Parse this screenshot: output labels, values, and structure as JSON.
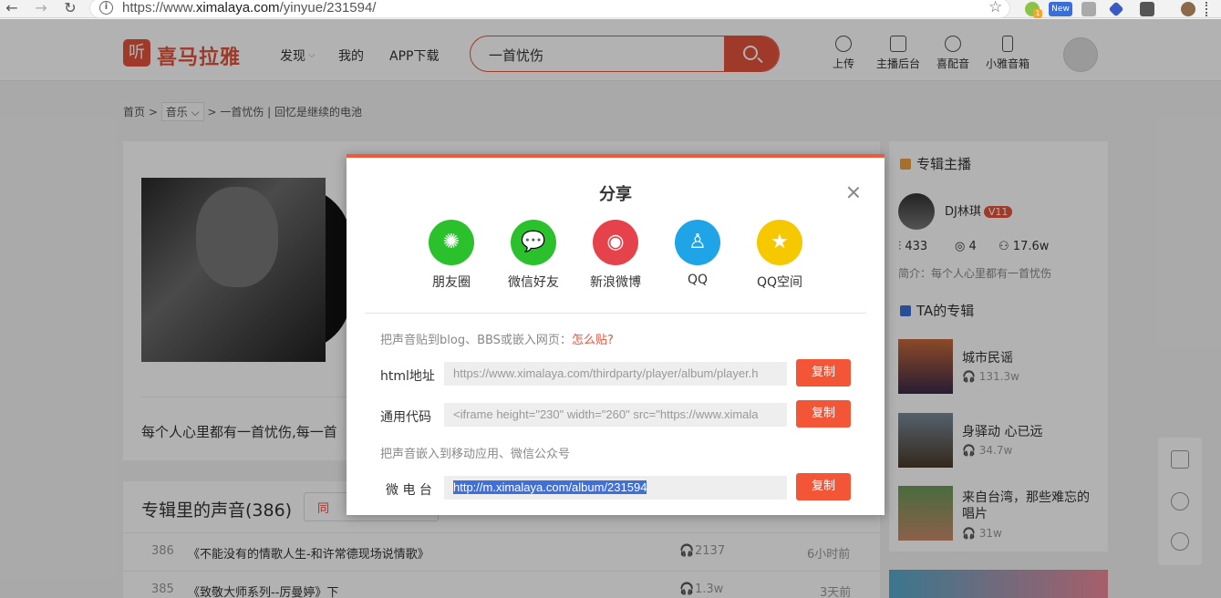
{
  "browser": {
    "back": "←",
    "forward": "→",
    "reload": "↻",
    "url_info": "i",
    "url_prefix": "https://www.",
    "url_domain": "ximalaya.com",
    "url_path": "/yinyue/231594/",
    "star": "☆",
    "ext_badge_new": "New",
    "ext_badge_count": "1"
  },
  "header": {
    "logo_glyph": "听",
    "logo_text": "喜马拉雅",
    "nav": [
      "发现",
      "我的",
      "APP下载"
    ],
    "search_value": "一首忧伤",
    "tools": [
      "上传",
      "主播后台",
      "喜配音",
      "小雅音箱"
    ]
  },
  "breadcrumb": {
    "home": "首页 >",
    "category": "音乐",
    "current": "> 一首忧伤 | 回忆是继续的电池"
  },
  "album": {
    "description": "每个人心里都有一首忧伤,每一首",
    "list_title": "专辑里的声音(386)",
    "sort_label": "同",
    "tracks": [
      {
        "num": "386",
        "title": "《不能没有的情歌人生-和许常德现场说情歌》",
        "plays": "2137",
        "time": "6小时前"
      },
      {
        "num": "385",
        "title": "《致敬大师系列--厉曼婷》下",
        "plays": "1.3w",
        "time": "3天前"
      }
    ]
  },
  "sidebar": {
    "anchor_heading": "专辑主播",
    "anchor_name": "DJ林琪",
    "anchor_level": "V11",
    "stats": [
      "433",
      "4",
      "17.6w"
    ],
    "intro": "简介：每个人心里都有一首忧伤",
    "albums_heading": "TA的专辑",
    "albums": [
      {
        "title": "城市民谣",
        "plays": "131.3w"
      },
      {
        "title": "身驿动 心已远",
        "plays": "34.7w"
      },
      {
        "title": "来自台湾，那些难忘的唱片",
        "plays": "31w"
      }
    ]
  },
  "modal": {
    "title": "分享",
    "share_targets": [
      {
        "label": "朋友圈",
        "color": "#2bc12d",
        "icon": "moments-icon"
      },
      {
        "label": "微信好友",
        "color": "#2bc12d",
        "icon": "wechat-icon"
      },
      {
        "label": "新浪微博",
        "color": "#e6424b",
        "icon": "weibo-icon"
      },
      {
        "label": "QQ",
        "color": "#1fa4e8",
        "icon": "qq-icon"
      },
      {
        "label": "QQ空间",
        "color": "#f6c800",
        "icon": "qzone-icon"
      }
    ],
    "embed_hint": "把声音贴到blog、BBS或嵌入网页：",
    "embed_how": "怎么贴?",
    "html_label": "html地址",
    "html_value": "https://www.ximalaya.com/thirdparty/player/album/player.h",
    "code_label": "通用代码",
    "code_value": "<iframe height=\"230\" width=\"260\" src=\"https://www.ximala",
    "mobile_hint": "把声音嵌入到移动应用、微信公众号",
    "weitai_label": "微 电 台",
    "weitai_value": "http://m.ximalaya.com/album/231594",
    "copy_label": "复制"
  }
}
